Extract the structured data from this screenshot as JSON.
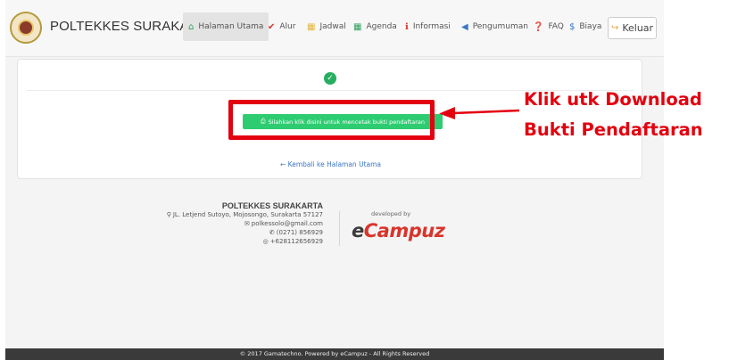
{
  "navbar": {
    "brand": "POLTEKKES SURAKARTA",
    "items": [
      {
        "label": "Halaman Utama",
        "icon": "home-icon",
        "glyph": "⌂",
        "color": "#2e9e5b"
      },
      {
        "label": "Alur",
        "icon": "checkmark-icon",
        "glyph": "✔",
        "color": "#d9342b"
      },
      {
        "label": "Jadwal",
        "icon": "calendar-icon",
        "glyph": "▦",
        "color": "#e6b53c"
      },
      {
        "label": "Agenda",
        "icon": "calendar-check-icon",
        "glyph": "▦",
        "color": "#2e9e5b"
      },
      {
        "label": "Informasi",
        "icon": "info-icon",
        "glyph": "ℹ",
        "color": "#d9342b"
      },
      {
        "label": "Pengumuman",
        "icon": "bullhorn-icon",
        "glyph": "📢",
        "color": "#3a76c9"
      },
      {
        "label": "FAQ",
        "icon": "question-icon",
        "glyph": "?",
        "color": "#e6a23c"
      },
      {
        "label": "Biaya",
        "icon": "dollar-icon",
        "glyph": "$",
        "color": "#3a76c9"
      }
    ],
    "logout_label": "Keluar"
  },
  "card": {
    "print_label": "Silahkan klik disini untuk mencetak bukti pendaftaran",
    "back_label": "Kembali ke Halaman Utama"
  },
  "annotation": {
    "line1": "Klik utk Download",
    "line2": "Bukti  Pendaftaran",
    "color": "#e3000f"
  },
  "footer": {
    "name": "POLTEKKES SURAKARTA",
    "address": "JL. Letjend Sutoyo, Mojosongo, Surakarta 57127",
    "email": "polkessolo@gmail.com",
    "phone": "(0271) 856929",
    "whatsapp": "+628112656929",
    "developed_by": "developed by",
    "brand_e": "e",
    "brand_rest": "Campuz",
    "copyright": "© 2017 Gamatechno. Powered by eCampuz - All Rights Reserved"
  }
}
